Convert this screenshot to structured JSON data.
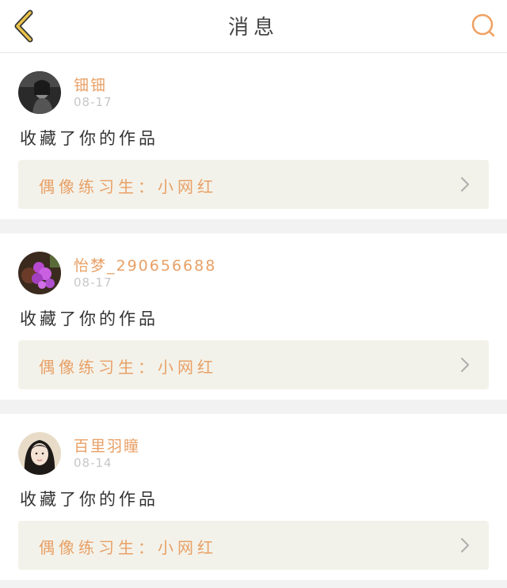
{
  "header": {
    "title": "消息",
    "back_icon": "chevron-left-icon",
    "search_icon": "search-icon",
    "accent_color": "#e9c24a",
    "search_color": "#f0a060"
  },
  "messages": [
    {
      "username": "钿钿",
      "date": "08-17",
      "action": "收藏了你的作品",
      "work": "偶像练习生：小网红",
      "avatar": "avatar-dark-portrait"
    },
    {
      "username": "怡梦_290656688",
      "date": "08-17",
      "action": "收藏了你的作品",
      "work": "偶像练习生：小网红",
      "avatar": "avatar-purple-flowers"
    },
    {
      "username": "百里羽瞳",
      "date": "08-14",
      "action": "收藏了你的作品",
      "work": "偶像练习生：小网红",
      "avatar": "avatar-girl-portrait"
    }
  ],
  "colors": {
    "username": "#e8a066",
    "date": "#c7c7c7",
    "link_bg": "#f3f2ea",
    "separator": "#f2f2f2"
  }
}
